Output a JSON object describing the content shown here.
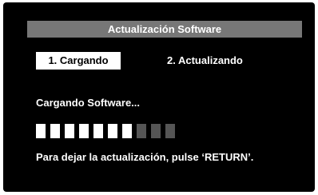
{
  "dialog": {
    "title": "Actualización Software",
    "steps": [
      {
        "label": "1. Cargando",
        "active": true
      },
      {
        "label": "2. Actualizando",
        "active": false
      }
    ],
    "status": "Cargando Software...",
    "progress": {
      "total_segments": 10,
      "filled_segments": 7
    },
    "hint": "Para dejar la actualización, pulse ‘RETURN’."
  },
  "colors": {
    "background": "#000000",
    "title_bar": "#777777",
    "text": "#ffffff",
    "segment_filled": "#ffffff",
    "segment_empty": "#555555"
  }
}
